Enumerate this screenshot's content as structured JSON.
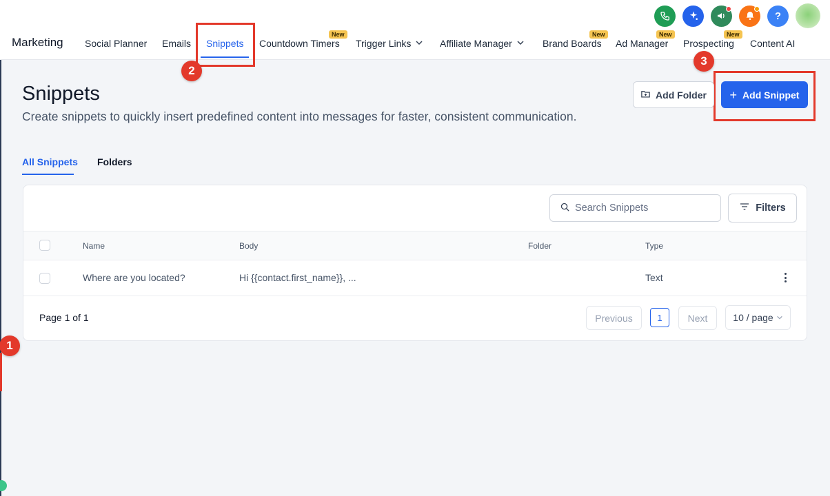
{
  "app": {
    "brand": "Marketing"
  },
  "nav": {
    "items": [
      {
        "label": "Social Planner"
      },
      {
        "label": "Emails"
      },
      {
        "label": "Snippets"
      },
      {
        "label": "Countdown Timers",
        "badge": "New"
      },
      {
        "label": "Trigger Links"
      },
      {
        "label": "Affiliate Manager"
      },
      {
        "label": "Brand Boards",
        "badge": "New"
      },
      {
        "label": "Ad Manager",
        "badge": "New"
      },
      {
        "label": "Prospecting",
        "badge": "New"
      },
      {
        "label": "Content AI"
      }
    ],
    "active": "Snippets"
  },
  "top_icons": [
    "phone-icon",
    "sparkle-icon",
    "megaphone-icon",
    "bell-icon",
    "help-icon",
    "avatar"
  ],
  "help_label": "?",
  "annotations": [
    "1",
    "2",
    "3"
  ],
  "page": {
    "title": "Snippets",
    "subtitle": "Create snippets to quickly insert predefined content into messages for faster, consistent communication.",
    "add_folder_label": "Add Folder",
    "add_snippet_label": "Add Snippet",
    "add_snippet_plus": "+"
  },
  "tabs": [
    {
      "label": "All Snippets",
      "active": true
    },
    {
      "label": "Folders",
      "active": false
    }
  ],
  "search": {
    "placeholder": "Search Snippets"
  },
  "filters_label": "Filters",
  "table": {
    "columns": [
      "Name",
      "Body",
      "Folder",
      "Type"
    ],
    "rows": [
      {
        "name": "Where are you located?",
        "body": "Hi {{contact.first_name}}, ...",
        "folder": "",
        "type": "Text"
      }
    ]
  },
  "pagination": {
    "info": "Page 1 of 1",
    "previous": "Previous",
    "current": "1",
    "next": "Next",
    "page_size": "10 / page"
  },
  "colors": {
    "accent": "#2563eb",
    "annotation": "#e3392b",
    "badge": "#f5c451"
  }
}
